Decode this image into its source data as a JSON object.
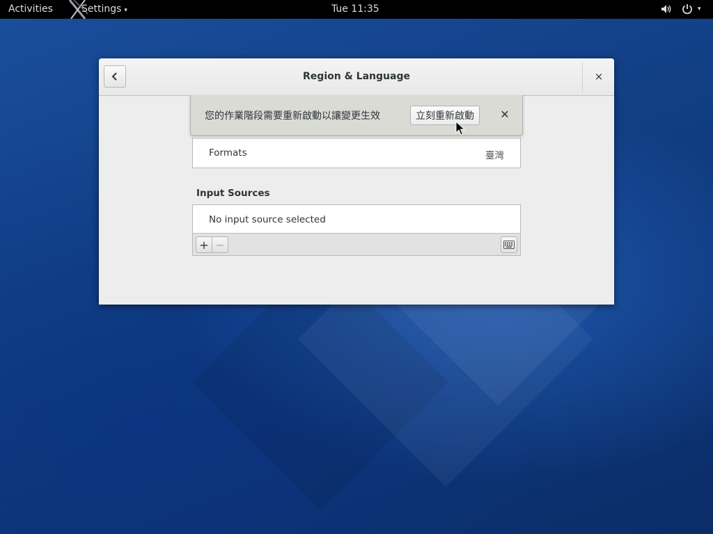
{
  "topbar": {
    "activities": "Activities",
    "app_menu": "Settings",
    "app_menu_arrow": "▾",
    "clock": "Tue 11:35",
    "system_arrow": "▾"
  },
  "window": {
    "title": "Region & Language",
    "close_glyph": "×"
  },
  "infobar": {
    "message": "您的作業階段需要重新啟動以讓變更生效",
    "restart_label": "立刻重新啟動",
    "dismiss_glyph": "✕"
  },
  "formats": {
    "label": "Formats",
    "value": "臺灣"
  },
  "input_sources": {
    "title": "Input Sources",
    "empty_text": "No input source selected",
    "add_glyph": "+",
    "remove_glyph": "−"
  }
}
